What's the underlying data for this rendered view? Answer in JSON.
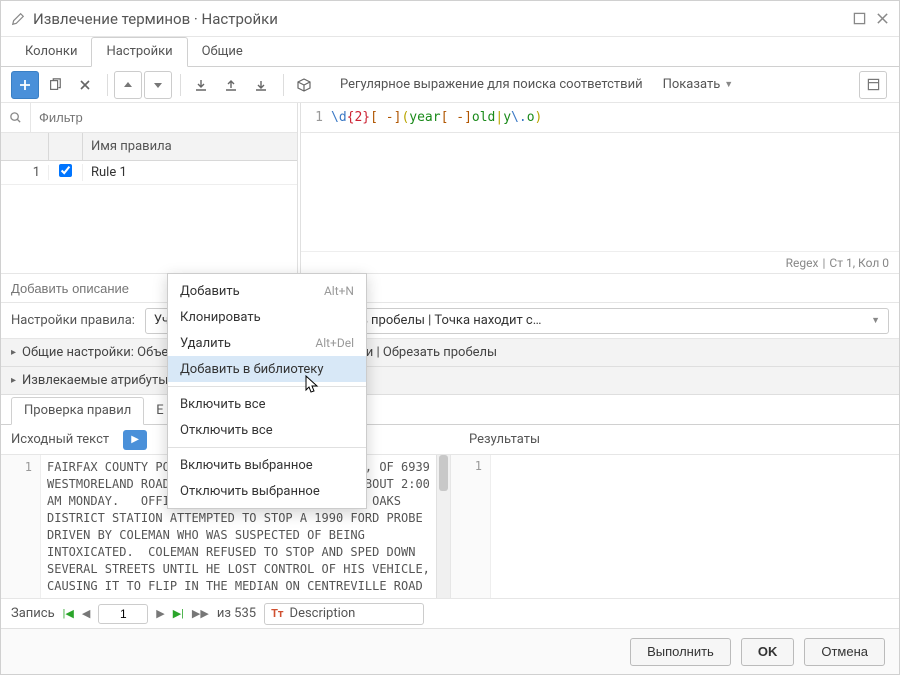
{
  "titlebar": {
    "title": "Извлечение терминов · Настройки"
  },
  "tabs": {
    "columns": "Колонки",
    "settings": "Настройки",
    "general": "Общие"
  },
  "toolbar": {
    "match_label": "Регулярное выражение для поиска соответствий",
    "show_dd": "Показать"
  },
  "filter": {
    "placeholder": "Фильтр"
  },
  "grid": {
    "header_rule": "Имя правила",
    "rows": [
      {
        "n": "1",
        "checked": true,
        "name": "Rule 1"
      }
    ]
  },
  "regex": {
    "line": "1",
    "raw": "\\d{2}[ -](year[ -]old|y\\.o)"
  },
  "status": {
    "regex": "Regex",
    "pos": "Ст 1, Кол 0"
  },
  "desc": {
    "placeholder": "Добавить описание"
  },
  "rulesettings": {
    "label": "Настройки правила:",
    "value": "Учитывать регистр | Игнорировать пробелы | Точка находит с…"
  },
  "accordion": {
    "general": "Общие настройки: Объединить результирующие колонки | Обрезать пробелы",
    "extracted": "Извлекаемые атрибуты: (Исходные колонки)"
  },
  "subtabs": {
    "rulecheck": "Проверка правил",
    "second": "Е"
  },
  "srcres": {
    "source": "Исходный текст",
    "results": "Результаты"
  },
  "source": {
    "line": "1",
    "text": "FAIRFAX COUNTY POLICE SAY RODNEY COLEMAN, 19, OF 6939 WESTMORELAND ROAD IN THE CENTREVILLE AREA, ABOUT 2:00 AM MONDAY.   OFFICER WYATT DAVIS OF THE FAIR OAKS DISTRICT STATION ATTEMPTED TO STOP A 1990 FORD PROBE DRIVEN BY COLEMAN WHO WAS SUSPECTED OF BEING INTOXICATED.  COLEMAN REFUSED TO STOP AND SPED DOWN SEVERAL STREETS UNTIL HE LOST CONTROL OF HIS VEHICLE, CAUSING IT TO FLIP IN THE MEDIAN ON CENTREVILLE ROAD NEAR MCLEAREN ROAD.   COLEMAN, WHO WAS PARTIALLY EJECTED,"
  },
  "results": {
    "line": "1"
  },
  "record": {
    "label": "Запись",
    "page": "1",
    "of": "из 535",
    "field": "Description"
  },
  "footer": {
    "run": "Выполнить",
    "ok": "OK",
    "cancel": "Отмена"
  },
  "ctxmenu": {
    "add": "Добавить",
    "add_sc": "Alt+N",
    "clone": "Клонировать",
    "delete": "Удалить",
    "delete_sc": "Alt+Del",
    "addlib": "Добавить в библиотеку",
    "enable_all": "Включить все",
    "disable_all": "Отключить все",
    "enable_sel": "Включить выбранное",
    "disable_sel": "Отключить выбранное"
  }
}
